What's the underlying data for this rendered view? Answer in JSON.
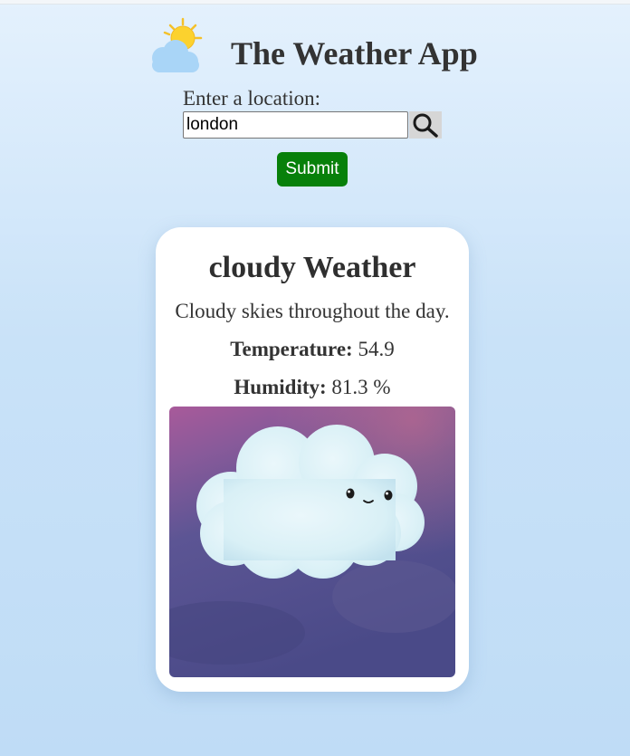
{
  "header": {
    "title": "The Weather App",
    "logo_icon": "sun-behind-cloud-icon"
  },
  "search": {
    "label": "Enter a location:",
    "input_value": "london",
    "search_icon": "search-icon",
    "submit_label": "Submit"
  },
  "weather": {
    "title": "cloudy Weather",
    "description": "Cloudy skies throughout the day.",
    "temperature_label": "Temperature:",
    "temperature_value": "54.9",
    "humidity_label": "Humidity:",
    "humidity_value": "81.3 %",
    "image_icon": "smiling-cloud-illustration"
  },
  "colors": {
    "submit_button": "#07800a",
    "background_top": "#e4f1fd",
    "background_bottom": "#bfdcf6",
    "card": "#ffffff",
    "illustration_sky_top": "#a85a9a",
    "illustration_sky_bottom": "#4a4a88"
  }
}
